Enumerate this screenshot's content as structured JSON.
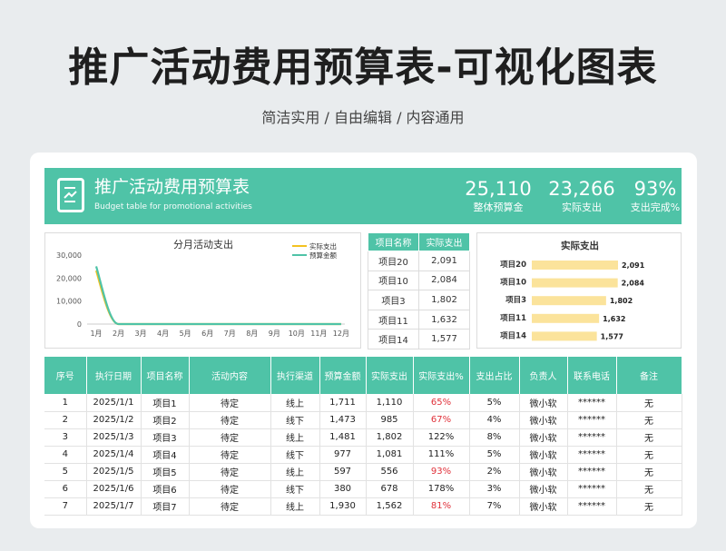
{
  "header": {
    "title": "推广活动费用预算表-可视化图表",
    "subtitle": "简洁实用 / 自由编辑 / 内容通用"
  },
  "banner": {
    "title": "推广活动费用预算表",
    "subtitle": "Budget table for promotional activities",
    "stats": [
      {
        "value": "25,110",
        "label": "整体预算金"
      },
      {
        "value": "23,266",
        "label": "实际支出"
      },
      {
        "value": "93%",
        "label": "支出完成%"
      }
    ]
  },
  "colors": {
    "accent": "#4fc3a7",
    "series_actual": "#f3c221",
    "series_budget": "#4fc3a7",
    "bar_fill": "#fbe39b",
    "red_text": "#e0313a"
  },
  "chart_data": [
    {
      "type": "line",
      "title": "分月活动支出",
      "categories": [
        "1月",
        "2月",
        "3月",
        "4月",
        "5月",
        "6月",
        "7月",
        "8月",
        "9月",
        "10月",
        "11月",
        "12月"
      ],
      "yticks": [
        "0",
        "10,000",
        "20,000",
        "30,000"
      ],
      "ylim": [
        0,
        30000
      ],
      "legend_position": "top-right",
      "series": [
        {
          "name": "实际支出",
          "values": [
            23266,
            0,
            0,
            0,
            0,
            0,
            0,
            0,
            0,
            0,
            0,
            0
          ]
        },
        {
          "name": "预算金额",
          "values": [
            25110,
            0,
            0,
            0,
            0,
            0,
            0,
            0,
            0,
            0,
            0,
            0
          ]
        }
      ]
    },
    {
      "type": "table",
      "columns": [
        "项目名称",
        "实际支出"
      ],
      "rows": [
        [
          "项目20",
          "2,091"
        ],
        [
          "项目10",
          "2,084"
        ],
        [
          "项目3",
          "1,802"
        ],
        [
          "项目11",
          "1,632"
        ],
        [
          "项目14",
          "1,577"
        ]
      ]
    },
    {
      "type": "bar",
      "orientation": "horizontal",
      "title": "实际支出",
      "categories": [
        "项目20",
        "项目10",
        "项目3",
        "项目11",
        "项目14"
      ],
      "values": [
        2091,
        2084,
        1802,
        1632,
        1577
      ],
      "labels": [
        "2,091",
        "2,084",
        "1,802",
        "1,632",
        "1,577"
      ]
    }
  ],
  "table": {
    "columns": [
      "序号",
      "执行日期",
      "项目名称",
      "活动内容",
      "执行渠道",
      "预算金额",
      "实际支出",
      "实际支出%",
      "支出占比",
      "负责人",
      "联系电话",
      "备注"
    ],
    "rows": [
      [
        "1",
        "2025/1/1",
        "项目1",
        "待定",
        "线上",
        "1,711",
        "1,110",
        "65%",
        "5%",
        "微小软",
        "******",
        "无"
      ],
      [
        "2",
        "2025/1/2",
        "项目2",
        "待定",
        "线下",
        "1,473",
        "985",
        "67%",
        "4%",
        "微小软",
        "******",
        "无"
      ],
      [
        "3",
        "2025/1/3",
        "项目3",
        "待定",
        "线上",
        "1,481",
        "1,802",
        "122%",
        "8%",
        "微小软",
        "******",
        "无"
      ],
      [
        "4",
        "2025/1/4",
        "项目4",
        "待定",
        "线下",
        "977",
        "1,081",
        "111%",
        "5%",
        "微小软",
        "******",
        "无"
      ],
      [
        "5",
        "2025/1/5",
        "项目5",
        "待定",
        "线上",
        "597",
        "556",
        "93%",
        "2%",
        "微小软",
        "******",
        "无"
      ],
      [
        "6",
        "2025/1/6",
        "项目6",
        "待定",
        "线下",
        "380",
        "678",
        "178%",
        "3%",
        "微小软",
        "******",
        "无"
      ],
      [
        "7",
        "2025/1/7",
        "项目7",
        "待定",
        "线上",
        "1,930",
        "1,562",
        "81%",
        "7%",
        "微小软",
        "******",
        "无"
      ]
    ]
  }
}
